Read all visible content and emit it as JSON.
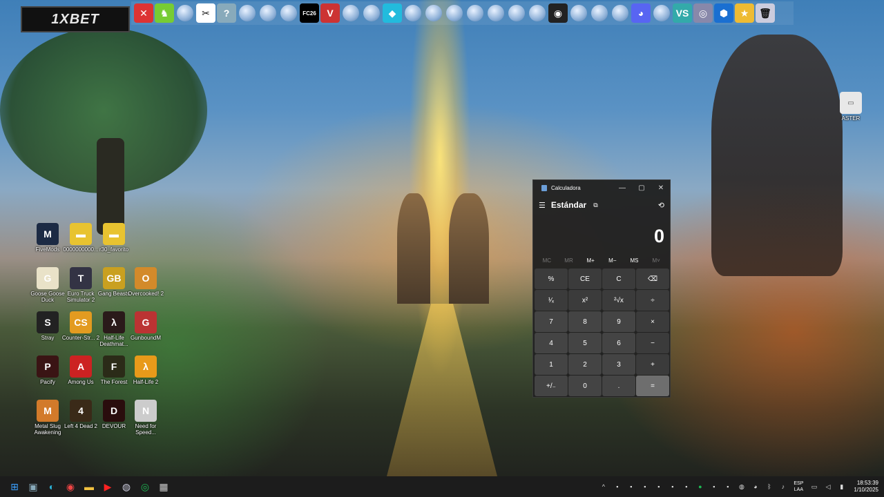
{
  "brand": {
    "label": "1XBET"
  },
  "top_launcher": {
    "items": [
      {
        "icon": "red-x-icon",
        "glyph": "✕",
        "color": "#d33"
      },
      {
        "icon": "green-figure-icon",
        "glyph": "♞",
        "color": "#7c3"
      },
      {
        "icon": "browser-globe-icon",
        "glyph": "",
        "color": "#8fb1d8"
      },
      {
        "icon": "capcut-icon",
        "glyph": "✂",
        "color": "#fff"
      },
      {
        "icon": "help-icon",
        "glyph": "?",
        "color": "#8ab"
      },
      {
        "icon": "browser-globe-icon",
        "glyph": "",
        "color": "#8fb1d8"
      },
      {
        "icon": "browser-globe-icon",
        "glyph": "",
        "color": "#8fb1d8"
      },
      {
        "icon": "browser-globe-icon",
        "glyph": "",
        "color": "#8fb1d8"
      },
      {
        "icon": "fc26-icon",
        "glyph": "FC26",
        "color": "#000"
      },
      {
        "icon": "valorant-icon",
        "glyph": "V",
        "color": "#c33"
      },
      {
        "icon": "browser-globe-icon",
        "glyph": "",
        "color": "#8fb1d8"
      },
      {
        "icon": "browser-globe-icon",
        "glyph": "",
        "color": "#8fb1d8"
      },
      {
        "icon": "diamond-app-icon",
        "glyph": "◆",
        "color": "#2bd"
      },
      {
        "icon": "browser-globe-icon",
        "glyph": "",
        "color": "#8fb1d8"
      },
      {
        "icon": "browser-globe-icon",
        "glyph": "",
        "color": "#8fb1d8"
      },
      {
        "icon": "browser-globe-icon",
        "glyph": "",
        "color": "#8fb1d8"
      },
      {
        "icon": "browser-globe-icon",
        "glyph": "",
        "color": "#8fb1d8"
      },
      {
        "icon": "browser-globe-icon",
        "glyph": "",
        "color": "#8fb1d8"
      },
      {
        "icon": "browser-globe-icon",
        "glyph": "",
        "color": "#8fb1d8"
      },
      {
        "icon": "browser-globe-icon",
        "glyph": "",
        "color": "#8fb1d8"
      },
      {
        "icon": "obs-icon",
        "glyph": "◉",
        "color": "#222"
      },
      {
        "icon": "browser-globe-icon",
        "glyph": "",
        "color": "#8fb1d8"
      },
      {
        "icon": "browser-globe-icon",
        "glyph": "",
        "color": "#8fb1d8"
      },
      {
        "icon": "browser-globe-icon",
        "glyph": "",
        "color": "#8fb1d8"
      },
      {
        "icon": "discord-icon",
        "glyph": "◕",
        "color": "#5865f2"
      },
      {
        "icon": "browser-globe-icon",
        "glyph": "",
        "color": "#8fb1d8"
      },
      {
        "icon": "vs-icon",
        "glyph": "VS",
        "color": "#3aa"
      },
      {
        "icon": "shield-app-icon",
        "glyph": "◎",
        "color": "#88a"
      },
      {
        "icon": "hex-app-icon",
        "glyph": "⬢",
        "color": "#1a6fd1"
      },
      {
        "icon": "star-app-icon",
        "glyph": "★",
        "color": "#eb3"
      },
      {
        "icon": "recycle-bin-icon",
        "glyph": "🗑",
        "color": "#ccd"
      }
    ]
  },
  "right_desktop_icon": {
    "label": "ASTER"
  },
  "desktop_icons": [
    {
      "label": "FiveMods",
      "color": "#1c2a44",
      "glyph": "M",
      "col": 0,
      "row": 0
    },
    {
      "label": "0000000000...",
      "color": "#e8c330",
      "glyph": "▬",
      "col": 1,
      "row": 0
    },
    {
      "label": "r30_favorito",
      "color": "#e8c330",
      "glyph": "▬",
      "col": 2,
      "row": 0
    },
    {
      "label": "Goose Goose Duck",
      "color": "#e9e2c8",
      "glyph": "G",
      "col": 0,
      "row": 1
    },
    {
      "label": "Euro Truck Simulator 2",
      "color": "#334",
      "glyph": "T",
      "col": 1,
      "row": 1
    },
    {
      "label": "Gang Beasts",
      "color": "#c9a020",
      "glyph": "GB",
      "col": 2,
      "row": 1
    },
    {
      "label": "Overcooked! 2",
      "color": "#d38a2a",
      "glyph": "O",
      "col": 3,
      "row": 1
    },
    {
      "label": "Stray",
      "color": "#222",
      "glyph": "S",
      "col": 0,
      "row": 2
    },
    {
      "label": "Counter-Str... 2",
      "color": "#e39b20",
      "glyph": "CS",
      "col": 1,
      "row": 2
    },
    {
      "label": "Half-Life Deathmat...",
      "color": "#2a1a1a",
      "glyph": "λ",
      "col": 2,
      "row": 2
    },
    {
      "label": "GunboundM",
      "color": "#b33",
      "glyph": "G",
      "col": 3,
      "row": 2
    },
    {
      "label": "Pacify",
      "color": "#3a1414",
      "glyph": "P",
      "col": 0,
      "row": 3
    },
    {
      "label": "Among Us",
      "color": "#c22",
      "glyph": "A",
      "col": 1,
      "row": 3
    },
    {
      "label": "The Forest",
      "color": "#2b2b18",
      "glyph": "F",
      "col": 2,
      "row": 3
    },
    {
      "label": "Half-Life 2",
      "color": "#e89a1a",
      "glyph": "λ",
      "col": 3,
      "row": 3
    },
    {
      "label": "Metal Slug Awakening",
      "color": "#d27a2a",
      "glyph": "M",
      "col": 0,
      "row": 4
    },
    {
      "label": "Left 4 Dead 2",
      "color": "#3a2a18",
      "glyph": "4",
      "col": 1,
      "row": 4
    },
    {
      "label": "DEVOUR",
      "color": "#2a0d0d",
      "glyph": "D",
      "col": 2,
      "row": 4
    },
    {
      "label": "Need for Speed...",
      "color": "#ccc",
      "glyph": "N",
      "col": 3,
      "row": 4
    }
  ],
  "calculator": {
    "title": "Calculadora",
    "mode": "Estándar",
    "display": "0",
    "memory": [
      "MC",
      "MR",
      "M+",
      "M−",
      "MS",
      "M˅"
    ],
    "keys": [
      {
        "label": "%",
        "kind": "op"
      },
      {
        "label": "CE",
        "kind": "op"
      },
      {
        "label": "C",
        "kind": "op"
      },
      {
        "label": "⌫",
        "kind": "op"
      },
      {
        "label": "¹⁄ₓ",
        "kind": "op"
      },
      {
        "label": "x²",
        "kind": "op"
      },
      {
        "label": "²√x",
        "kind": "op"
      },
      {
        "label": "÷",
        "kind": "op"
      },
      {
        "label": "7",
        "kind": "num"
      },
      {
        "label": "8",
        "kind": "num"
      },
      {
        "label": "9",
        "kind": "num"
      },
      {
        "label": "×",
        "kind": "op"
      },
      {
        "label": "4",
        "kind": "num"
      },
      {
        "label": "5",
        "kind": "num"
      },
      {
        "label": "6",
        "kind": "num"
      },
      {
        "label": "−",
        "kind": "op"
      },
      {
        "label": "1",
        "kind": "num"
      },
      {
        "label": "2",
        "kind": "num"
      },
      {
        "label": "3",
        "kind": "num"
      },
      {
        "label": "+",
        "kind": "op"
      },
      {
        "label": "+/₋",
        "kind": "num"
      },
      {
        "label": "0",
        "kind": "num"
      },
      {
        "label": ".",
        "kind": "num"
      },
      {
        "label": "=",
        "kind": "eq"
      }
    ]
  },
  "taskbar": {
    "apps": [
      {
        "icon": "windows-start-icon",
        "glyph": "⊞",
        "color": "#3aa0ff"
      },
      {
        "icon": "people-app-icon",
        "glyph": "▣",
        "color": "#8ab"
      },
      {
        "icon": "edge-icon",
        "glyph": "◐",
        "color": "#2bb3d6"
      },
      {
        "icon": "chrome-icon",
        "glyph": "◉",
        "color": "#e44"
      },
      {
        "icon": "file-explorer-icon",
        "glyph": "▬",
        "color": "#f0c040"
      },
      {
        "icon": "youtube-icon",
        "glyph": "▶",
        "color": "#f22"
      },
      {
        "icon": "steam-icon",
        "glyph": "◍",
        "color": "#ccd"
      },
      {
        "icon": "spotify-icon",
        "glyph": "◎",
        "color": "#1db954"
      },
      {
        "icon": "calculator-taskbar-icon",
        "glyph": "▦",
        "color": "#ccc"
      }
    ],
    "tray_icons": [
      "chevron-up-icon",
      "tray-app-icon",
      "tray-app-icon",
      "tray-app-icon",
      "tray-app-icon",
      "tray-app-icon",
      "tray-app-icon",
      "spotify-tray-icon",
      "tray-app-icon",
      "tray-app-icon",
      "steam-tray-icon",
      "discord-tray-icon",
      "bluetooth-icon",
      "mic-icon"
    ],
    "language": {
      "line1": "ESP",
      "line2": "LAA"
    },
    "time": "18:53:39",
    "date": "1/10/2025"
  }
}
